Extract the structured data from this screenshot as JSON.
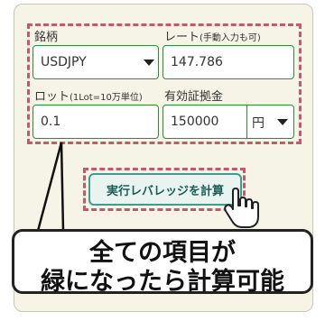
{
  "form": {
    "symbol_label": "銘柄",
    "rate_label": "レート",
    "rate_hint": "(手動入力も可)",
    "symbol_value": "USDJPY",
    "rate_value": "147.786",
    "lot_label": "ロット",
    "lot_hint": "(1Lot=10万単位)",
    "margin_label": "有効証拠金",
    "lot_value": "0.1",
    "margin_value": "150000",
    "currency_value": "円"
  },
  "button": {
    "calc_label": "実行レバレッジを計算"
  },
  "callout": {
    "line1": "全ての項目が",
    "line2": "緑になったら計算可能"
  },
  "colors": {
    "valid_border": "#2e8b3a",
    "dash_highlight": "#c05a6e",
    "button_border": "#3aa08a"
  }
}
